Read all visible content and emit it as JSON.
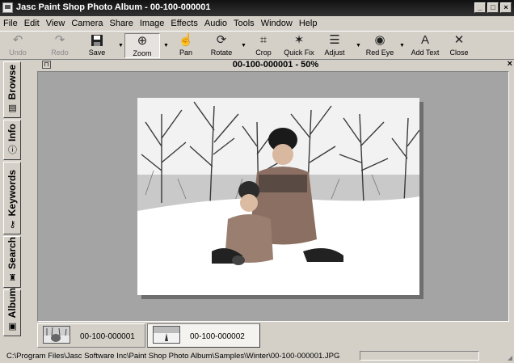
{
  "window": {
    "title": "Jasc Paint Shop Photo Album - 00-100-000001",
    "controls": [
      "_",
      "□",
      "×"
    ]
  },
  "menu": [
    "File",
    "Edit",
    "View",
    "Camera",
    "Share",
    "Image",
    "Effects",
    "Audio",
    "Tools",
    "Window",
    "Help"
  ],
  "toolbar": {
    "undo": "Undo",
    "redo": "Redo",
    "save": "Save",
    "zoom": "Zoom",
    "pan": "Pan",
    "rotate": "Rotate",
    "crop": "Crop",
    "quick_fix": "Quick Fix",
    "adjust": "Adjust",
    "red_eye": "Red Eye",
    "add_text": "Add Text",
    "close": "Close"
  },
  "side_tabs": [
    "Browse",
    "Info",
    "Keywords",
    "Search",
    "Album"
  ],
  "document": {
    "title": "00-100-000001 - 50%",
    "close": "×"
  },
  "filmstrip": [
    {
      "name": "00-100-000001"
    },
    {
      "name": "00-100-000002"
    }
  ],
  "status": {
    "path": "C:\\Program Files\\Jasc Software Inc\\Paint Shop Photo Album\\Samples\\Winter\\00-100-000001.JPG"
  },
  "colors": {
    "chrome": "#d4d0c8",
    "titlebar": "#222222",
    "canvas": "#a4a4a4"
  }
}
